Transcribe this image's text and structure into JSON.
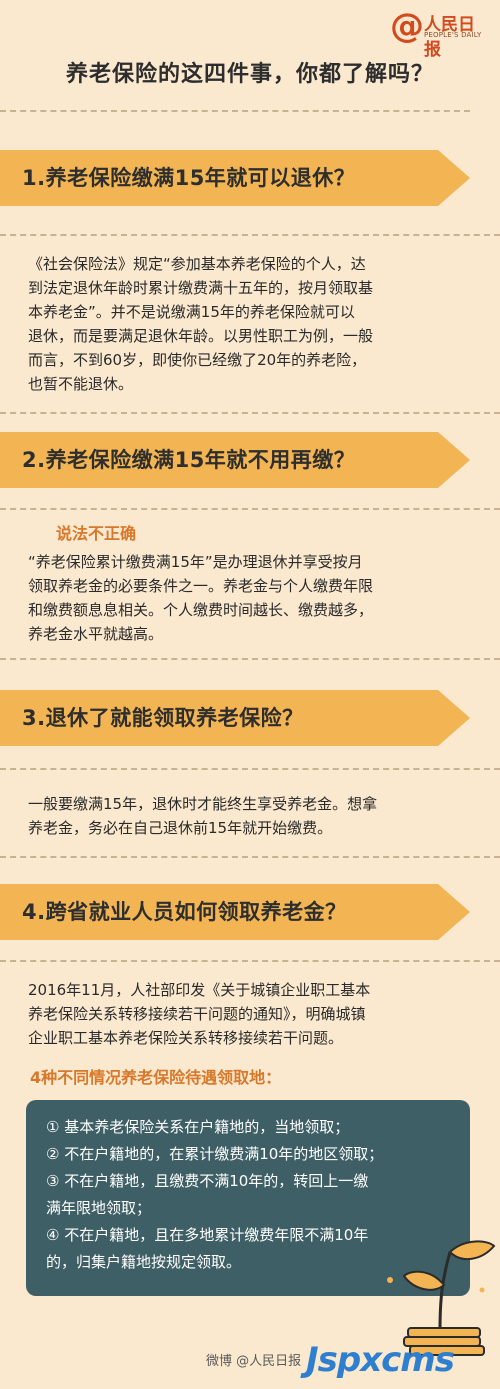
{
  "logo": {
    "name": "人民日报",
    "sub": "PEOPLE'S DAILY"
  },
  "title": "养老保险的这四件事，你都了解吗？",
  "sections": [
    {
      "heading": "1.养老保险缴满15年就可以退休？",
      "lines": [
        "《社会保险法》规定“参加基本养老保险的个人，达",
        "到法定退休年龄时累计缴费满十五年的，按月领取基",
        "本养老金”。并不是说缴满15年的养老保险就可以",
        "退休，而是要满足退休年龄。以男性职工为例，一般",
        "而言，不到60岁，即使你已经缴了20年的养老险，",
        "也暂不能退休。"
      ]
    },
    {
      "heading": "2.养老保险缴满15年就不用再缴？",
      "highlight": "说法不正确",
      "lines": [
        "“养老保险累计缴费满15年”是办理退休并享受按月",
        "领取养老金的必要条件之一。养老金与个人缴费年限",
        "和缴费额息息相关。个人缴费时间越长、缴费越多，",
        "养老金水平就越高。"
      ]
    },
    {
      "heading": "3.退休了就能领取养老保险？",
      "lines": [
        "一般要缴满15年，退休时才能终生享受养老金。想拿",
        "养老金，务必在自己退休前15年就开始缴费。"
      ]
    },
    {
      "heading": "4.跨省就业人员如何领取养老金？",
      "lines": [
        "2016年11月，人社部印发《关于城镇企业职工基本",
        "养老保险关系转移接续若干问题的通知》，明确城镇",
        "企业职工基本养老保险关系转移接续若干问题。"
      ],
      "highlight": "4种不同情况养老保险待遇领取地：",
      "box_lines": [
        "①  基本养老保险关系在户籍地的，当地领取；",
        "②  不在户籍地的，在累计缴费满10年的地区领取；",
        "③  不在户籍地，且缴费不满10年的，转回上一缴",
        "满年限地领取；",
        "④  不在户籍地，且在多地累计缴费年限不满10年",
        "的，归集户籍地按规定领取。"
      ]
    }
  ],
  "footer": {
    "weibo": "微博 @人民日报",
    "watermark": "Jspxcms"
  },
  "colors": {
    "background": "#fbe9cf",
    "banner": "#f3b553",
    "highlight": "#d7782a",
    "box": "#3f5f66"
  }
}
